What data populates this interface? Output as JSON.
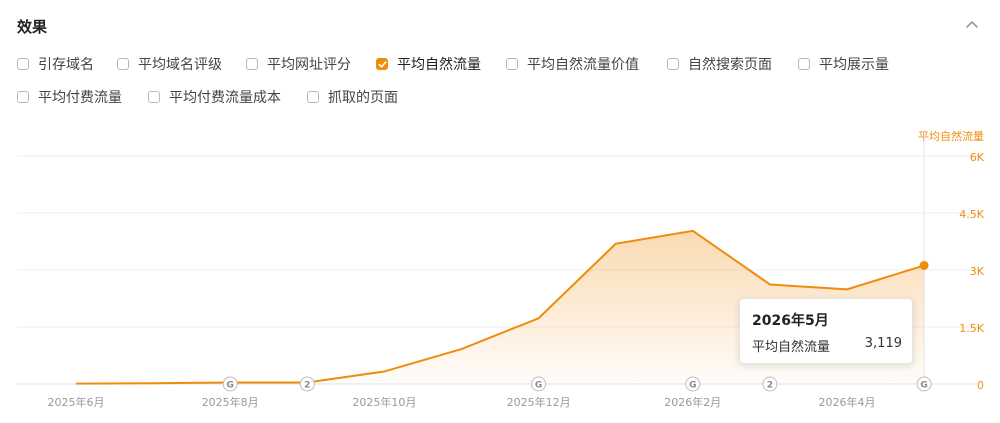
{
  "section": {
    "title": "效果"
  },
  "metrics": [
    {
      "label": "引存域名",
      "checked": false
    },
    {
      "label": "平均域名评级",
      "checked": false
    },
    {
      "label": "平均网址评分",
      "checked": false
    },
    {
      "label": "平均自然流量",
      "checked": true
    },
    {
      "label": "平均自然流量价值",
      "checked": false
    },
    {
      "label": "自然搜索页面",
      "checked": false
    },
    {
      "label": "平均展示量",
      "checked": false
    },
    {
      "label": "平均付费流量",
      "checked": false
    },
    {
      "label": "平均付费流量成本",
      "checked": false
    },
    {
      "label": "抓取的页面",
      "checked": false
    }
  ],
  "icons": {
    "collapse": "chevron-up-icon",
    "checkbox": "check-icon"
  },
  "colors": {
    "accent": "#f08c0c",
    "grid": "#eeeeee",
    "axis_text": "#999999"
  },
  "chart_data": {
    "type": "area",
    "y_axis_title": "平均自然流量",
    "x_tick_labels": [
      "2025年6月",
      "2025年8月",
      "2025年10月",
      "2025年12月",
      "2026年2月",
      "2026年4月"
    ],
    "y_tick_labels": [
      "0",
      "1.5K",
      "3K",
      "4.5K",
      "6K"
    ],
    "ylim": [
      0,
      6000
    ],
    "y_axis_position": "right",
    "grid": true,
    "series": [
      {
        "name": "平均自然流量",
        "x": [
          "2025年6月",
          "2025年7月",
          "2025年8月",
          "2025年9月",
          "2025年10月",
          "2025年11月",
          "2025年12月",
          "2026年1月",
          "2026年2月",
          "2026年3月",
          "2026年4月",
          "2026年5月"
        ],
        "values": [
          10,
          20,
          40,
          40,
          330,
          920,
          1730,
          3690,
          4030,
          2620,
          2490,
          3119
        ]
      }
    ],
    "markers": [
      {
        "x": "2025年8月",
        "label": "G"
      },
      {
        "x": "2025年9月",
        "label": "2"
      },
      {
        "x": "2025年12月",
        "label": "G"
      },
      {
        "x": "2026年2月",
        "label": "G"
      },
      {
        "x": "2026年3月",
        "label": "2"
      },
      {
        "x": "2026年5月",
        "label": "G"
      }
    ],
    "tooltip": {
      "title": "2026年5月",
      "series": "平均自然流量",
      "value": "3,119"
    }
  }
}
